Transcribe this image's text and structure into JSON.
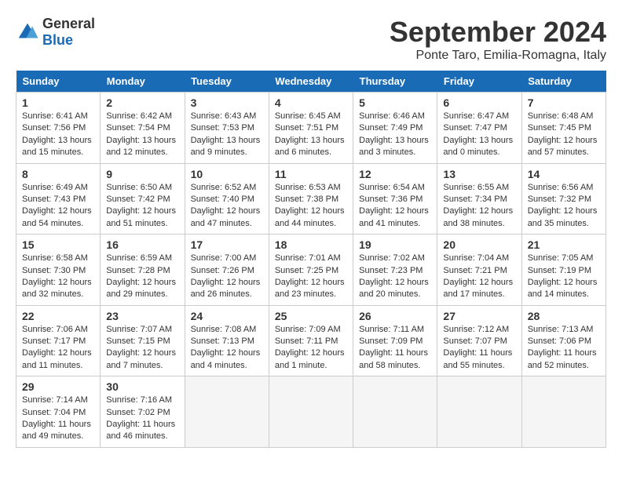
{
  "header": {
    "logo_general": "General",
    "logo_blue": "Blue",
    "month_title": "September 2024",
    "subtitle": "Ponte Taro, Emilia-Romagna, Italy"
  },
  "columns": [
    "Sunday",
    "Monday",
    "Tuesday",
    "Wednesday",
    "Thursday",
    "Friday",
    "Saturday"
  ],
  "weeks": [
    [
      {
        "day": "1",
        "info": "Sunrise: 6:41 AM\nSunset: 7:56 PM\nDaylight: 13 hours\nand 15 minutes."
      },
      {
        "day": "2",
        "info": "Sunrise: 6:42 AM\nSunset: 7:54 PM\nDaylight: 13 hours\nand 12 minutes."
      },
      {
        "day": "3",
        "info": "Sunrise: 6:43 AM\nSunset: 7:53 PM\nDaylight: 13 hours\nand 9 minutes."
      },
      {
        "day": "4",
        "info": "Sunrise: 6:45 AM\nSunset: 7:51 PM\nDaylight: 13 hours\nand 6 minutes."
      },
      {
        "day": "5",
        "info": "Sunrise: 6:46 AM\nSunset: 7:49 PM\nDaylight: 13 hours\nand 3 minutes."
      },
      {
        "day": "6",
        "info": "Sunrise: 6:47 AM\nSunset: 7:47 PM\nDaylight: 13 hours\nand 0 minutes."
      },
      {
        "day": "7",
        "info": "Sunrise: 6:48 AM\nSunset: 7:45 PM\nDaylight: 12 hours\nand 57 minutes."
      }
    ],
    [
      {
        "day": "8",
        "info": "Sunrise: 6:49 AM\nSunset: 7:43 PM\nDaylight: 12 hours\nand 54 minutes."
      },
      {
        "day": "9",
        "info": "Sunrise: 6:50 AM\nSunset: 7:42 PM\nDaylight: 12 hours\nand 51 minutes."
      },
      {
        "day": "10",
        "info": "Sunrise: 6:52 AM\nSunset: 7:40 PM\nDaylight: 12 hours\nand 47 minutes."
      },
      {
        "day": "11",
        "info": "Sunrise: 6:53 AM\nSunset: 7:38 PM\nDaylight: 12 hours\nand 44 minutes."
      },
      {
        "day": "12",
        "info": "Sunrise: 6:54 AM\nSunset: 7:36 PM\nDaylight: 12 hours\nand 41 minutes."
      },
      {
        "day": "13",
        "info": "Sunrise: 6:55 AM\nSunset: 7:34 PM\nDaylight: 12 hours\nand 38 minutes."
      },
      {
        "day": "14",
        "info": "Sunrise: 6:56 AM\nSunset: 7:32 PM\nDaylight: 12 hours\nand 35 minutes."
      }
    ],
    [
      {
        "day": "15",
        "info": "Sunrise: 6:58 AM\nSunset: 7:30 PM\nDaylight: 12 hours\nand 32 minutes."
      },
      {
        "day": "16",
        "info": "Sunrise: 6:59 AM\nSunset: 7:28 PM\nDaylight: 12 hours\nand 29 minutes."
      },
      {
        "day": "17",
        "info": "Sunrise: 7:00 AM\nSunset: 7:26 PM\nDaylight: 12 hours\nand 26 minutes."
      },
      {
        "day": "18",
        "info": "Sunrise: 7:01 AM\nSunset: 7:25 PM\nDaylight: 12 hours\nand 23 minutes."
      },
      {
        "day": "19",
        "info": "Sunrise: 7:02 AM\nSunset: 7:23 PM\nDaylight: 12 hours\nand 20 minutes."
      },
      {
        "day": "20",
        "info": "Sunrise: 7:04 AM\nSunset: 7:21 PM\nDaylight: 12 hours\nand 17 minutes."
      },
      {
        "day": "21",
        "info": "Sunrise: 7:05 AM\nSunset: 7:19 PM\nDaylight: 12 hours\nand 14 minutes."
      }
    ],
    [
      {
        "day": "22",
        "info": "Sunrise: 7:06 AM\nSunset: 7:17 PM\nDaylight: 12 hours\nand 11 minutes."
      },
      {
        "day": "23",
        "info": "Sunrise: 7:07 AM\nSunset: 7:15 PM\nDaylight: 12 hours\nand 7 minutes."
      },
      {
        "day": "24",
        "info": "Sunrise: 7:08 AM\nSunset: 7:13 PM\nDaylight: 12 hours\nand 4 minutes."
      },
      {
        "day": "25",
        "info": "Sunrise: 7:09 AM\nSunset: 7:11 PM\nDaylight: 12 hours\nand 1 minute."
      },
      {
        "day": "26",
        "info": "Sunrise: 7:11 AM\nSunset: 7:09 PM\nDaylight: 11 hours\nand 58 minutes."
      },
      {
        "day": "27",
        "info": "Sunrise: 7:12 AM\nSunset: 7:07 PM\nDaylight: 11 hours\nand 55 minutes."
      },
      {
        "day": "28",
        "info": "Sunrise: 7:13 AM\nSunset: 7:06 PM\nDaylight: 11 hours\nand 52 minutes."
      }
    ],
    [
      {
        "day": "29",
        "info": "Sunrise: 7:14 AM\nSunset: 7:04 PM\nDaylight: 11 hours\nand 49 minutes."
      },
      {
        "day": "30",
        "info": "Sunrise: 7:16 AM\nSunset: 7:02 PM\nDaylight: 11 hours\nand 46 minutes."
      },
      {
        "day": "",
        "info": ""
      },
      {
        "day": "",
        "info": ""
      },
      {
        "day": "",
        "info": ""
      },
      {
        "day": "",
        "info": ""
      },
      {
        "day": "",
        "info": ""
      }
    ]
  ]
}
